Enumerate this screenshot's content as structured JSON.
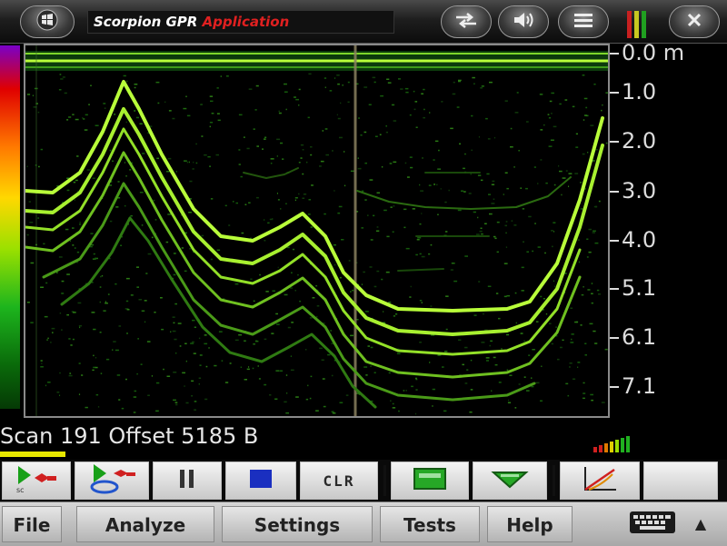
{
  "titlebar": {
    "title_white": "Scorpion GPR",
    "title_red": "Application",
    "icons": [
      "windows-start-icon",
      "connectivity-icon",
      "volume-icon",
      "list-icon",
      "signal-icon",
      "close-icon"
    ]
  },
  "colors": {
    "accent_red": "#e02020",
    "trace_green": "#b9ff3a",
    "trace_dark_green": "#1f8a1f",
    "progress_yellow": "#e8e800"
  },
  "depth_axis": {
    "labels": [
      "0.0 m",
      "1.0",
      "2.0",
      "3.0",
      "4.0",
      "5.1",
      "6.1",
      "7.1"
    ],
    "unit": "m"
  },
  "status": {
    "text": "Scan 191 Offset 5185 B",
    "progress_fraction": 0.09
  },
  "toolbar": {
    "clr_label": "CLR",
    "buttons": [
      "start-scan-icon",
      "start-scan-save-icon",
      "pause-icon",
      "stop-icon",
      "clr",
      "display-window-icon",
      "collapse-view-icon",
      "graph-icon"
    ]
  },
  "menu": {
    "items": [
      "File",
      "Analyze",
      "Settings",
      "Tests",
      "Help"
    ],
    "keyboard_icon": "keyboard-icon",
    "expand_icon": "caret-up-icon"
  }
}
